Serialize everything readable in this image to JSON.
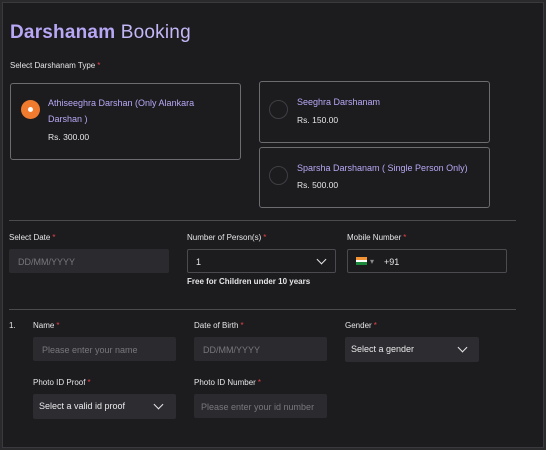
{
  "header": {
    "title_accent": "Darshanam",
    "title_rest": " Booking"
  },
  "darshanam_type": {
    "label": "Select Darshanam Type",
    "required_mark": "*",
    "options": [
      {
        "name_line1": "Athiseeghra Darshan (Only Alankara",
        "name_line2": "Darshan )",
        "price": "Rs. 300.00",
        "selected": true
      },
      {
        "name_line1": "Seeghra Darshanam",
        "name_line2": "",
        "price": "Rs. 150.00",
        "selected": false
      },
      {
        "name_line1": "Sparsha Darshanam ( Single Person Only)",
        "name_line2": "",
        "price": "Rs. 500.00",
        "selected": false
      }
    ]
  },
  "booking": {
    "date_label": "Select Date",
    "date_placeholder": "DD/MM/YYYY",
    "persons_label": "Number of Person(s)",
    "persons_value": "1",
    "persons_hint": "Free for Children under 10 years",
    "mobile_label": "Mobile Number",
    "mobile_code": "+91",
    "mobile_flag": [
      "#f29434",
      "#ffffff",
      "#1b8a3a"
    ]
  },
  "person": {
    "index": "1.",
    "name_label": "Name",
    "name_placeholder": "Please enter your name",
    "dob_label": "Date of Birth",
    "dob_placeholder": "DD/MM/YYYY",
    "gender_label": "Gender",
    "gender_placeholder": "Select a gender",
    "idproof_label": "Photo ID Proof",
    "idproof_placeholder": "Select a valid id proof",
    "idnumber_label": "Photo ID Number",
    "idnumber_placeholder": "Please enter your id number"
  },
  "colors": {
    "accent": "#f07b2e",
    "title": "#b7a7f5",
    "required": "#e2444a",
    "background": "#1c1b1e"
  }
}
